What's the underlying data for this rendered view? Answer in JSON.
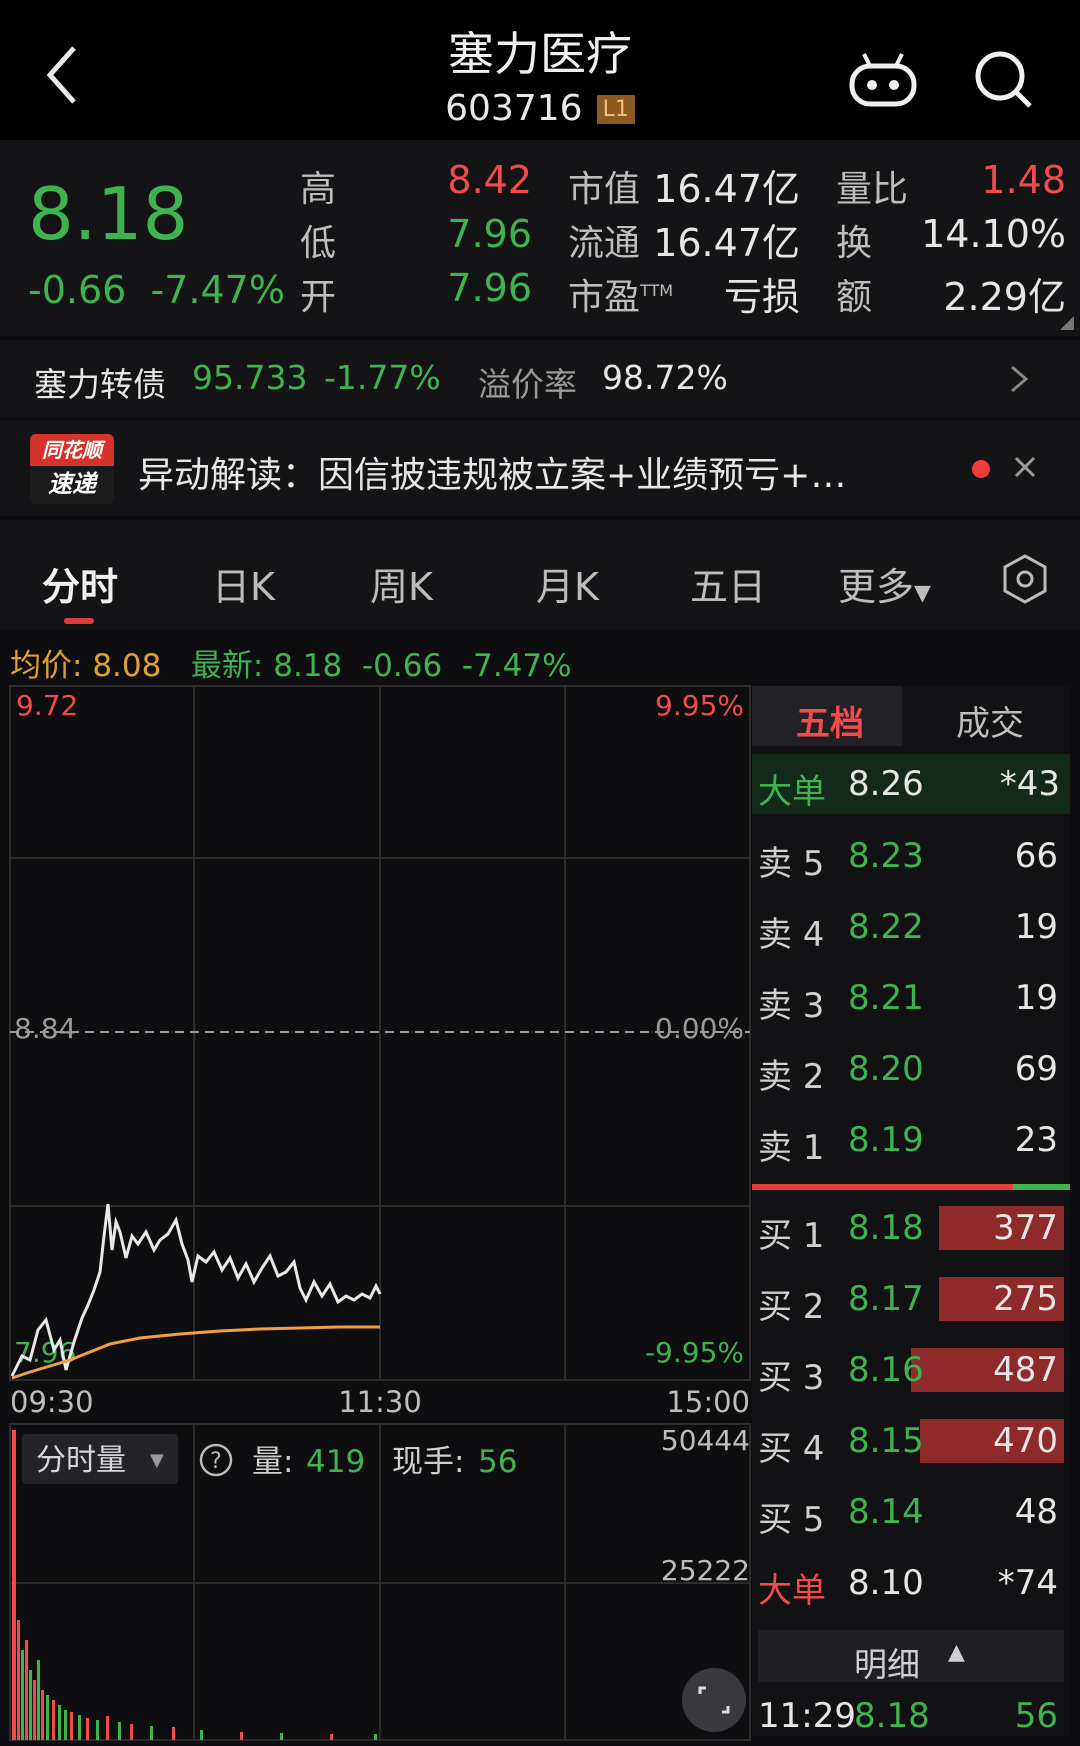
{
  "header": {
    "title": "塞力医疗",
    "code": "603716",
    "level_badge": "L1"
  },
  "quote": {
    "price": "8.18",
    "change": "-0.66",
    "change_pct": "-7.47%",
    "high_label": "高",
    "high": "8.42",
    "low_label": "低",
    "low": "7.96",
    "open_label": "开",
    "open": "7.96",
    "mcap_label": "市值",
    "mcap": "16.47亿",
    "float_label": "流通",
    "float": "16.47亿",
    "pe_label": "市盈",
    "pe_sup": "TTM",
    "pe": "亏损",
    "vol_ratio_label": "量比",
    "vol_ratio": "1.48",
    "turnover_label": "换",
    "turnover": "14.10%",
    "amount_label": "额",
    "amount": "2.29亿"
  },
  "bond": {
    "name": "塞力转债",
    "price": "95.733",
    "pct": "-1.77%",
    "premium_label": "溢价率",
    "premium": "98.72%"
  },
  "news": {
    "logo_top": "同花顺",
    "logo_bottom": "速递",
    "text": "异动解读：因信披违规被立案+业绩预亏+…"
  },
  "tabs": [
    "分时",
    "日K",
    "周K",
    "月K",
    "五日",
    "更多"
  ],
  "chart_info": {
    "avg_label": "均价:",
    "avg": "8.08",
    "latest_label": "最新:",
    "latest": "8.18",
    "chg": "-0.66",
    "pct": "-7.47%"
  },
  "chart_axis": {
    "price_top": "9.72",
    "pct_top": "9.95%",
    "price_mid": "8.84",
    "pct_mid": "0.00%",
    "price_bottom": "7.96",
    "pct_bottom": "-9.95%",
    "time_start": "09:30",
    "time_mid": "11:30",
    "time_end": "15:00"
  },
  "volume": {
    "dropdown": "分时量",
    "vol_label": "量:",
    "vol": "419",
    "hand_label": "现手:",
    "hand": "56",
    "max": "50444",
    "mid": "25222"
  },
  "book": {
    "tab_active": "五档",
    "tab_other": "成交",
    "big_sell": {
      "label": "大单",
      "price": "8.26",
      "qty": "*43"
    },
    "sells": [
      {
        "label": "卖 5",
        "price": "8.23",
        "qty": "66"
      },
      {
        "label": "卖 4",
        "price": "8.22",
        "qty": "19"
      },
      {
        "label": "卖 3",
        "price": "8.21",
        "qty": "19"
      },
      {
        "label": "卖 2",
        "price": "8.20",
        "qty": "69"
      },
      {
        "label": "卖 1",
        "price": "8.19",
        "qty": "23"
      }
    ],
    "buys": [
      {
        "label": "买 1",
        "price": "8.18",
        "qty": "377",
        "bar": 0.41
      },
      {
        "label": "买 2",
        "price": "8.17",
        "qty": "275",
        "bar": 0.41
      },
      {
        "label": "买 3",
        "price": "8.16",
        "qty": "487",
        "bar": 0.5
      },
      {
        "label": "买 4",
        "price": "8.15",
        "qty": "470",
        "bar": 0.47
      },
      {
        "label": "买 5",
        "price": "8.14",
        "qty": "48",
        "bar": 0
      }
    ],
    "big_buy": {
      "label": "大单",
      "price": "8.10",
      "qty": "*74"
    },
    "detail_label": "明细",
    "last_trade": {
      "time": "11:29",
      "price": "8.18",
      "qty": "56"
    }
  },
  "colors": {
    "up": "#f24b4b",
    "down": "#3fb34f",
    "bg": "#0e0e10",
    "avg_line": "#f0a040",
    "price_line": "#e8e8e8"
  }
}
